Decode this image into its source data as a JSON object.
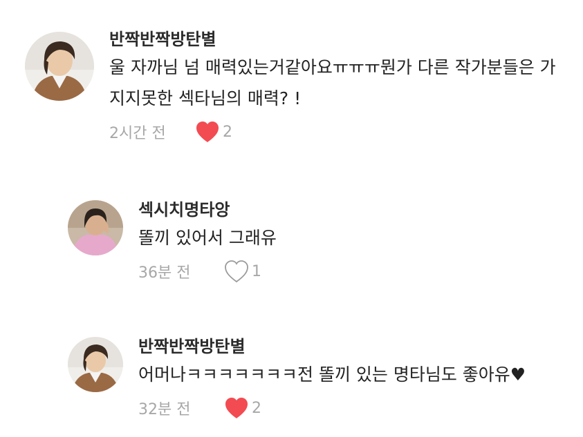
{
  "comments": [
    {
      "username": "반짝반짝방탄별",
      "text": "울 자까님 넘 매력있는거같아요ㅠㅠㅠ뭔가 다른 작가분들은 가지지못한 섹타님의 매력? !",
      "time": "2시간 전",
      "likes": "2",
      "liked": true,
      "avatar": "avatar-photo-brown-hair"
    },
    {
      "username": "섹시치명타앙",
      "text": "똘끼 있어서 그래유",
      "time": "36분 전",
      "likes": "1",
      "liked": false,
      "avatar": "avatar-photo-pink-shirt"
    },
    {
      "username": "반짝반짝방탄별",
      "text": "어머나ㅋㅋㅋㅋㅋㅋㅋ전 똘끼 있는 명타님도 좋아유♥",
      "time": "32분 전",
      "likes": "2",
      "liked": true,
      "avatar": "avatar-photo-brown-hair"
    }
  ],
  "colors": {
    "heart_filled": "#f24b52",
    "heart_outline": "#9a9a9a",
    "meta_text": "#a7a7a7"
  }
}
